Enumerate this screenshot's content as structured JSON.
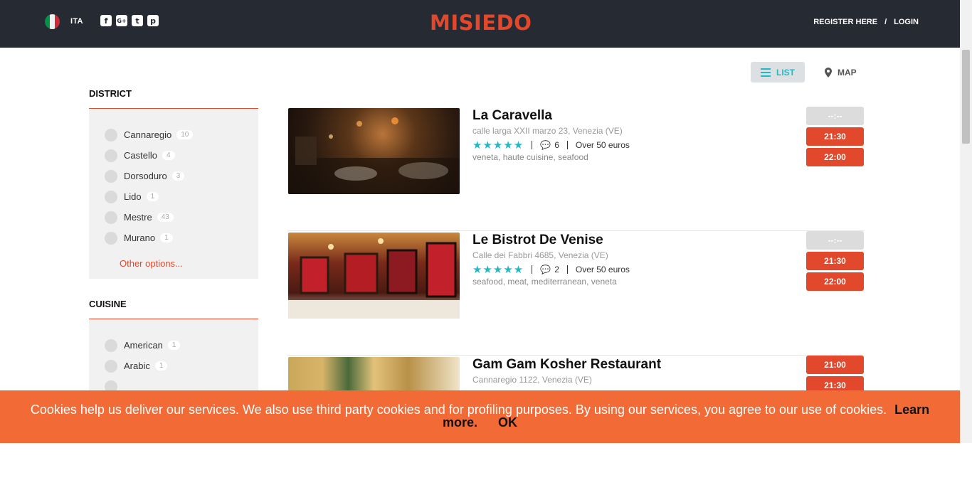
{
  "header": {
    "lang": "ITA",
    "logo": "MISIEDO",
    "register": "REGISTER HERE",
    "separator": "/",
    "login": "LOGIN",
    "social_icons": [
      "facebook-icon",
      "google-plus-icon",
      "twitter-icon",
      "pinterest-icon"
    ]
  },
  "view_toggle": {
    "list": "LIST",
    "map": "MAP"
  },
  "filters": {
    "district": {
      "title": "DISTRICT",
      "items": [
        {
          "label": "Cannaregio",
          "count": "10"
        },
        {
          "label": "Castello",
          "count": "4"
        },
        {
          "label": "Dorsoduro",
          "count": "3"
        },
        {
          "label": "Lido",
          "count": "1"
        },
        {
          "label": "Mestre",
          "count": "43"
        },
        {
          "label": "Murano",
          "count": "1"
        }
      ],
      "other": "Other options..."
    },
    "cuisine": {
      "title": "CUISINE",
      "items": [
        {
          "label": "American",
          "count": "1"
        },
        {
          "label": "Arabic",
          "count": "1"
        }
      ]
    }
  },
  "restaurants": [
    {
      "name": "La Caravella",
      "address": "calle larga XXII marzo 23, Venezia (VE)",
      "stars": "★★★★★",
      "comments": "6",
      "price": "Over 50 euros",
      "tags": "veneta, haute cuisine, seafood",
      "slots": [
        "--:--",
        "21:30",
        "22:00"
      ]
    },
    {
      "name": "Le Bistrot De Venise",
      "address": "Calle dei Fabbri 4685, Venezia (VE)",
      "stars": "★★★★★",
      "comments": "2",
      "price": "Over 50 euros",
      "tags": "seafood, meat, mediterranean, veneta",
      "slots": [
        "--:--",
        "21:30",
        "22:00"
      ]
    },
    {
      "name": "Gam Gam Kosher Restaurant",
      "address": "Cannaregio 1122, Venezia (VE)",
      "slots": [
        "21:00",
        "21:30"
      ]
    }
  ],
  "cookie": {
    "text": "Cookies help us deliver our services. We also use third party cookies and for profiling purposes. By using our services, you agree to our use of cookies.",
    "learn_more": "Learn more.",
    "ok": "OK"
  },
  "colors": {
    "accent": "#e2482b",
    "teal": "#23b8c4",
    "header_bg": "#262a33",
    "cookie_bg": "#f26a36"
  }
}
